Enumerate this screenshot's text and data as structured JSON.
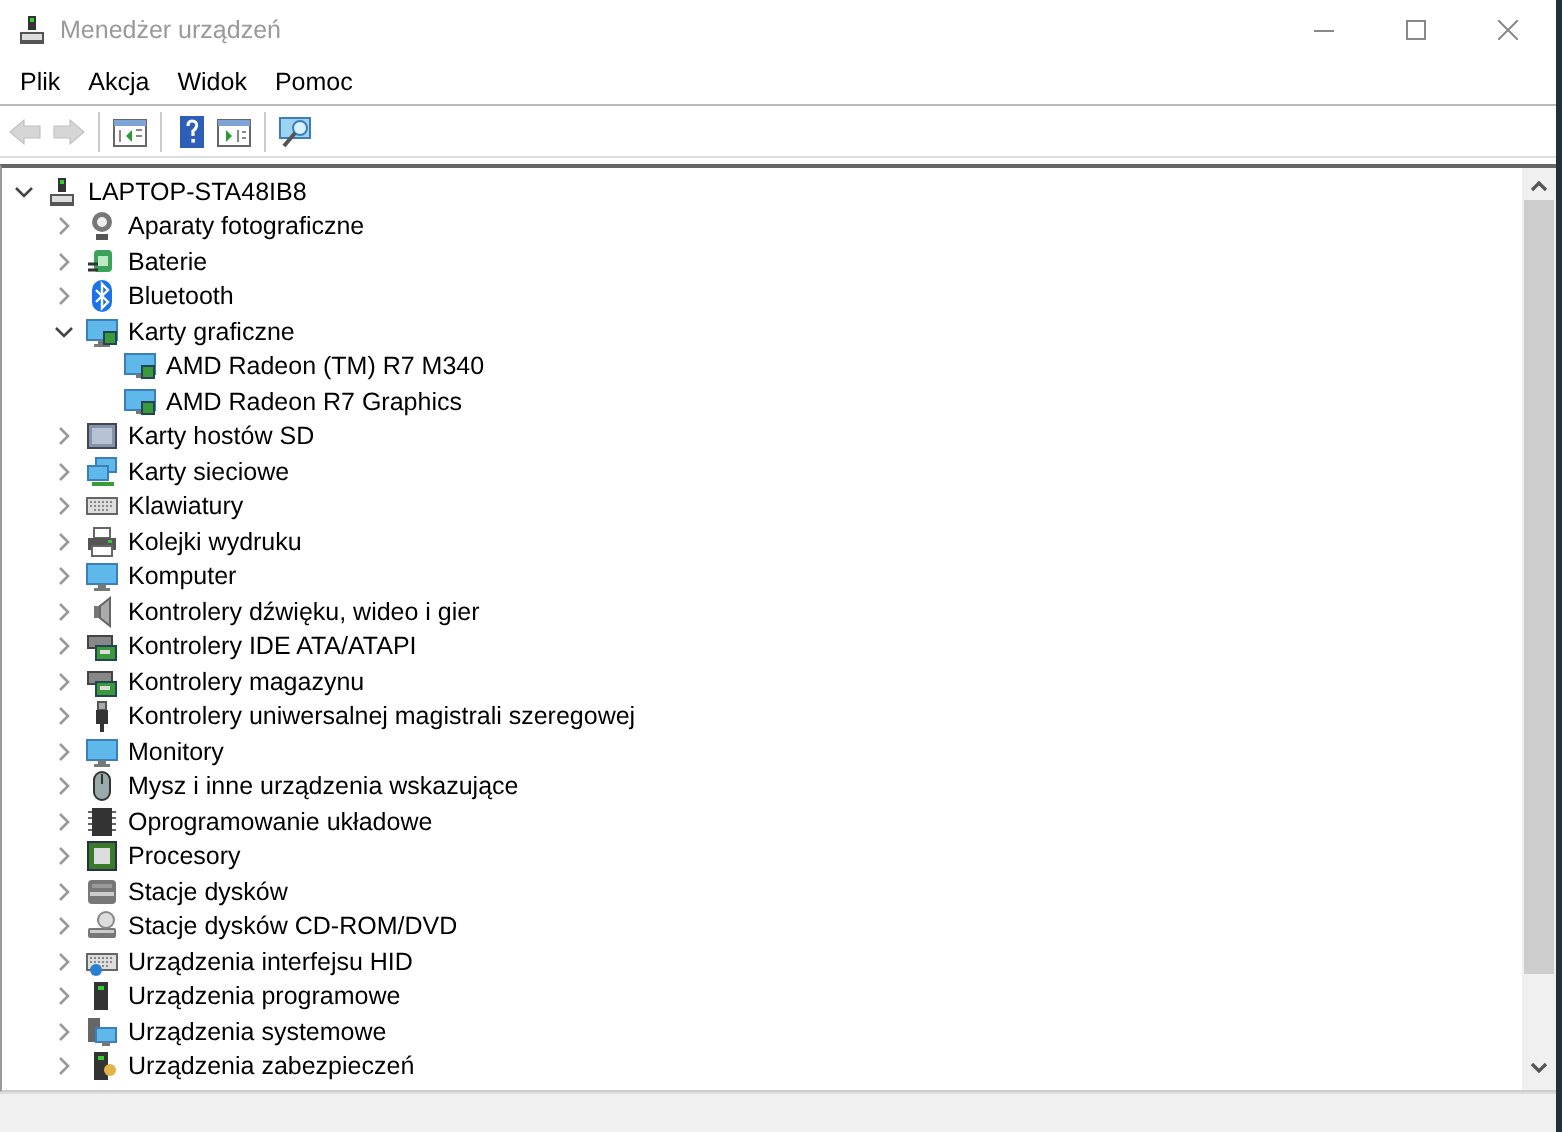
{
  "window": {
    "title": "Menedżer urządzeń"
  },
  "menu": [
    "Plik",
    "Akcja",
    "Widok",
    "Pomoc"
  ],
  "toolbar": [
    {
      "kind": "back",
      "disabled": true
    },
    {
      "kind": "forward",
      "disabled": true
    },
    {
      "kind": "properties",
      "disabled": false
    },
    {
      "kind": "help",
      "disabled": false
    },
    {
      "kind": "update",
      "disabled": false
    },
    {
      "kind": "scan",
      "disabled": false
    }
  ],
  "tree": {
    "label": "LAPTOP-STA48IB8",
    "expanded": true,
    "children": [
      {
        "label": "Aparaty fotograficzne",
        "expanded": false
      },
      {
        "label": "Baterie",
        "expanded": false
      },
      {
        "label": "Bluetooth",
        "expanded": false
      },
      {
        "label": "Karty graficzne",
        "expanded": true,
        "children": [
          {
            "label": "AMD Radeon (TM) R7 M340"
          },
          {
            "label": "AMD Radeon R7 Graphics"
          }
        ]
      },
      {
        "label": "Karty hostów SD",
        "expanded": false
      },
      {
        "label": "Karty sieciowe",
        "expanded": false
      },
      {
        "label": "Klawiatury",
        "expanded": false
      },
      {
        "label": "Kolejki wydruku",
        "expanded": false
      },
      {
        "label": "Komputer",
        "expanded": false
      },
      {
        "label": "Kontrolery dźwięku, wideo i gier",
        "expanded": false
      },
      {
        "label": "Kontrolery IDE ATA/ATAPI",
        "expanded": false
      },
      {
        "label": "Kontrolery magazynu",
        "expanded": false
      },
      {
        "label": "Kontrolery uniwersalnej magistrali szeregowej",
        "expanded": false
      },
      {
        "label": "Monitory",
        "expanded": false
      },
      {
        "label": "Mysz i inne urządzenia wskazujące",
        "expanded": false
      },
      {
        "label": "Oprogramowanie układowe",
        "expanded": false
      },
      {
        "label": "Procesory",
        "expanded": false
      },
      {
        "label": "Stacje dysków",
        "expanded": false
      },
      {
        "label": "Stacje dysków CD-ROM/DVD",
        "expanded": false
      },
      {
        "label": "Urządzenia interfejsu HID",
        "expanded": false
      },
      {
        "label": "Urządzenia programowe",
        "expanded": false
      },
      {
        "label": "Urządzenia systemowe",
        "expanded": false
      },
      {
        "label": "Urządzenia zabezpieczeń",
        "expanded": false
      }
    ]
  }
}
